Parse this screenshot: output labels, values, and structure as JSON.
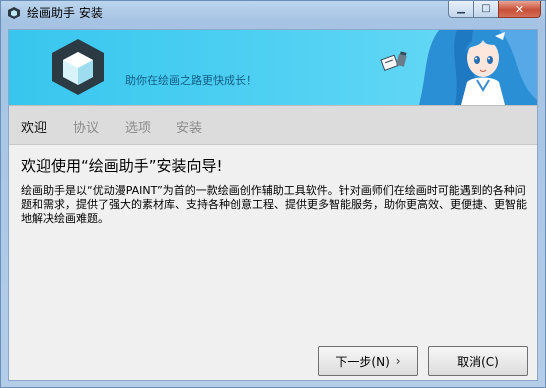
{
  "window": {
    "title": "绘画助手 安装",
    "minimize_glyph": "▁",
    "maximize_glyph": "□",
    "close_glyph": "✕"
  },
  "banner": {
    "slogan": "助你在绘画之路更快成长！"
  },
  "tabs": [
    {
      "label": "欢迎",
      "active": true
    },
    {
      "label": "协议",
      "active": false
    },
    {
      "label": "选项",
      "active": false
    },
    {
      "label": "安装",
      "active": false
    }
  ],
  "content": {
    "heading": "欢迎使用“绘画助手”安装向导!",
    "description": "绘画助手是以“优动漫PAINT”为首的一款绘画创作辅助工具软件。针对画师们在绘画时可能遇到的各种问题和需求，提供了强大的素材库、支持各种创意工程、提供更多智能服务，助你更高效、更便捷、更智能地解决绘画难题。"
  },
  "buttons": {
    "next_label": "下一步(N)",
    "next_arrow": "›",
    "cancel_label": "取消(C)"
  },
  "colors": {
    "banner_start": "#38c6ee",
    "banner_end": "#6ddaf6",
    "logo_dark": "#2c3a44",
    "accent_text": "#135e84"
  }
}
